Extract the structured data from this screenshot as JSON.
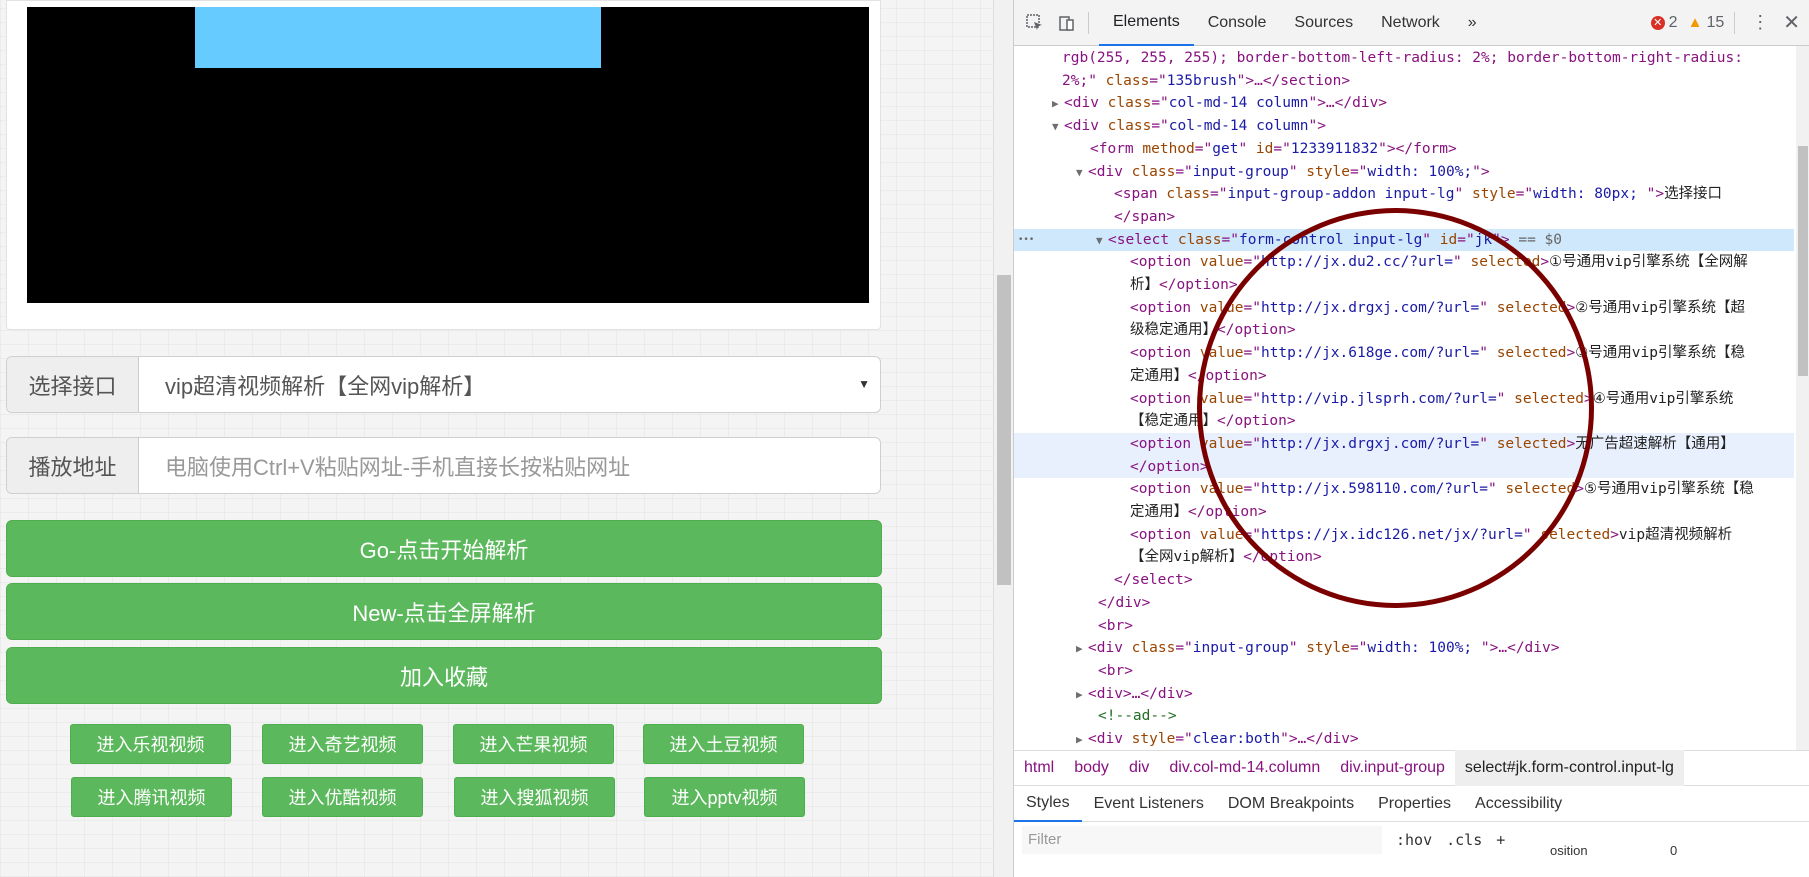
{
  "page": {
    "select_group": {
      "addon": "选择接口",
      "value": "vip超清视频解析【全网vip解析】"
    },
    "url_group": {
      "addon": "播放地址",
      "placeholder": "电脑使用Ctrl+V粘贴网址-手机直接长按粘贴网址"
    },
    "buttons": {
      "go": "Go-点击开始解析",
      "new": "New-点击全屏解析",
      "fav": "加入收藏"
    },
    "links": [
      "进入乐视视频",
      "进入奇艺视频",
      "进入芒果视频",
      "进入土豆视频",
      "进入腾讯视频",
      "进入优酷视频",
      "进入搜狐视频",
      "进入pptv视频"
    ]
  },
  "devtools": {
    "tabs": [
      "Elements",
      "Console",
      "Sources",
      "Network"
    ],
    "more": "»",
    "errors": "2",
    "warnings": "15",
    "code_lines": [
      [
        [
          "t",
          "rgb(255, 255, 255); border-bottom-left-radius: 2%; border-bottom-right-radius:"
        ]
      ],
      [
        [
          "t",
          "2%;\" "
        ],
        [
          "an",
          "class"
        ],
        [
          "t",
          "=\""
        ],
        [
          "av",
          "135brush"
        ],
        [
          "t",
          "\">…</section>"
        ]
      ],
      [
        [
          "tri",
          "▶"
        ],
        [
          "t",
          "<div "
        ],
        [
          "an",
          "class"
        ],
        [
          "t",
          "=\""
        ],
        [
          "av",
          "col-md-14 column"
        ],
        [
          "t",
          "\">…</div>"
        ]
      ],
      [
        [
          "tri",
          "▼"
        ],
        [
          "t",
          "<div "
        ],
        [
          "an",
          "class"
        ],
        [
          "t",
          "=\""
        ],
        [
          "av",
          "col-md-14 column"
        ],
        [
          "t",
          "\">"
        ]
      ],
      [
        [
          "t",
          "<form "
        ],
        [
          "an",
          "method"
        ],
        [
          "t",
          "=\""
        ],
        [
          "av",
          "get"
        ],
        [
          "t",
          "\" "
        ],
        [
          "an",
          "id"
        ],
        [
          "t",
          "=\""
        ],
        [
          "av",
          "1233911832"
        ],
        [
          "t",
          "\"></form>"
        ]
      ],
      [
        [
          "tri",
          "▼"
        ],
        [
          "t",
          "<div "
        ],
        [
          "an",
          "class"
        ],
        [
          "t",
          "=\""
        ],
        [
          "av",
          "input-group"
        ],
        [
          "t",
          "\" "
        ],
        [
          "an",
          "style"
        ],
        [
          "t",
          "=\""
        ],
        [
          "av",
          "width: 100%;"
        ],
        [
          "t",
          "\">"
        ]
      ],
      [
        [
          "t",
          "<span "
        ],
        [
          "an",
          "class"
        ],
        [
          "t",
          "=\""
        ],
        [
          "av",
          "input-group-addon input-lg"
        ],
        [
          "t",
          "\" "
        ],
        [
          "an",
          "style"
        ],
        [
          "t",
          "=\""
        ],
        [
          "av",
          "width: 80px; "
        ],
        [
          "t",
          "\">"
        ],
        [
          "tx",
          "选择接口"
        ]
      ],
      [
        [
          "t",
          "</span>"
        ]
      ],
      [
        [
          "tri",
          "▼"
        ],
        [
          "t",
          "<select "
        ],
        [
          "an",
          "class"
        ],
        [
          "t",
          "=\""
        ],
        [
          "av",
          "form-control input-lg"
        ],
        [
          "t",
          "\" "
        ],
        [
          "an",
          "id"
        ],
        [
          "t",
          "=\""
        ],
        [
          "av",
          "jk"
        ],
        [
          "t",
          "\">"
        ],
        [
          "dollar",
          " == $0"
        ]
      ],
      [
        [
          "t",
          "<option "
        ],
        [
          "an",
          "value"
        ],
        [
          "t",
          "=\""
        ],
        [
          "av",
          "http://jx.du2.cc/?url="
        ],
        [
          "t",
          "\" "
        ],
        [
          "an",
          "selected"
        ],
        [
          "t",
          ">"
        ],
        [
          "tx",
          "①号通用vip引擎系统【全网解"
        ]
      ],
      [
        [
          "tx",
          "析】"
        ],
        [
          "t",
          "</option>"
        ]
      ],
      [
        [
          "t",
          "<option "
        ],
        [
          "an",
          "value"
        ],
        [
          "t",
          "=\""
        ],
        [
          "av",
          "http://jx.drgxj.com/?url="
        ],
        [
          "t",
          "\" "
        ],
        [
          "an",
          "selected"
        ],
        [
          "t",
          ">"
        ],
        [
          "tx",
          "②号通用vip引擎系统【超"
        ]
      ],
      [
        [
          "tx",
          "级稳定通用】"
        ],
        [
          "t",
          "</option>"
        ]
      ],
      [
        [
          "t",
          "<option "
        ],
        [
          "an",
          "value"
        ],
        [
          "t",
          "=\""
        ],
        [
          "av",
          "http://jx.618ge.com/?url="
        ],
        [
          "t",
          "\" "
        ],
        [
          "an",
          "selected"
        ],
        [
          "t",
          ">"
        ],
        [
          "tx",
          "③号通用vip引擎系统【稳"
        ]
      ],
      [
        [
          "tx",
          "定通用】"
        ],
        [
          "t",
          "</option>"
        ]
      ],
      [
        [
          "t",
          "<option "
        ],
        [
          "an",
          "value"
        ],
        [
          "t",
          "=\""
        ],
        [
          "av",
          "http://vip.jlsprh.com/?url="
        ],
        [
          "t",
          "\" "
        ],
        [
          "an",
          "selected"
        ],
        [
          "t",
          ">"
        ],
        [
          "tx",
          "④号通用vip引擎系统"
        ]
      ],
      [
        [
          "tx",
          "【稳定通用】"
        ],
        [
          "t",
          "</option>"
        ]
      ],
      [
        [
          "t",
          "<option "
        ],
        [
          "an",
          "value"
        ],
        [
          "t",
          "=\""
        ],
        [
          "av",
          "http://jx.drgxj.com/?url="
        ],
        [
          "t",
          "\" "
        ],
        [
          "an",
          "selected"
        ],
        [
          "t",
          ">"
        ],
        [
          "tx",
          "无广告超速解析【通用】"
        ]
      ],
      [
        [
          "t",
          "</option>"
        ]
      ],
      [
        [
          "t",
          "<option "
        ],
        [
          "an",
          "value"
        ],
        [
          "t",
          "=\""
        ],
        [
          "av",
          "http://jx.598110.com/?url="
        ],
        [
          "t",
          "\" "
        ],
        [
          "an",
          "selected"
        ],
        [
          "t",
          ">"
        ],
        [
          "tx",
          "⑤号通用vip引擎系统【稳"
        ]
      ],
      [
        [
          "tx",
          "定通用】"
        ],
        [
          "t",
          "</option>"
        ]
      ],
      [
        [
          "t",
          "<option "
        ],
        [
          "an",
          "value"
        ],
        [
          "t",
          "=\""
        ],
        [
          "av",
          "https://jx.idc126.net/jx/?url="
        ],
        [
          "t",
          "\" "
        ],
        [
          "an",
          "selected"
        ],
        [
          "t",
          ">"
        ],
        [
          "tx",
          "vip超清视频解析"
        ]
      ],
      [
        [
          "tx",
          "【全网vip解析】"
        ],
        [
          "t",
          "</option>"
        ]
      ],
      [
        [
          "t",
          "</select>"
        ]
      ],
      [
        [
          "t",
          "</div>"
        ]
      ],
      [
        [
          "t",
          "<br>"
        ]
      ],
      [
        [
          "tri",
          "▶"
        ],
        [
          "t",
          "<div "
        ],
        [
          "an",
          "class"
        ],
        [
          "t",
          "=\""
        ],
        [
          "av",
          "input-group"
        ],
        [
          "t",
          "\" "
        ],
        [
          "an",
          "style"
        ],
        [
          "t",
          "=\""
        ],
        [
          "av",
          "width: 100%; "
        ],
        [
          "t",
          "\">…</div>"
        ]
      ],
      [
        [
          "t",
          "<br>"
        ]
      ],
      [
        [
          "tri",
          "▶"
        ],
        [
          "t",
          "<div>…</div>"
        ]
      ],
      [
        [
          "cm",
          "<!--ad-->"
        ]
      ],
      [
        [
          "tri",
          "▶"
        ],
        [
          "t",
          "<div "
        ],
        [
          "an",
          "style"
        ],
        [
          "t",
          "=\""
        ],
        [
          "av",
          "clear:both"
        ],
        [
          "t",
          "\">…</div>"
        ]
      ]
    ],
    "breadcrumb": [
      "html",
      "body",
      "div",
      "div.col-md-14.column",
      "div.input-group",
      "select#jk.form-control.input-lg"
    ],
    "subtabs": [
      "Styles",
      "Event Listeners",
      "DOM Breakpoints",
      "Properties",
      "Accessibility"
    ],
    "filter_placeholder": "Filter",
    "hov": ":hov",
    "cls": ".cls",
    "plus": "+",
    "position_label": "osition",
    "position_value": "0"
  },
  "colors": {
    "green": "#5cb85c",
    "annotation_circle": "#7a0000",
    "video_bar": "#66ccff"
  }
}
